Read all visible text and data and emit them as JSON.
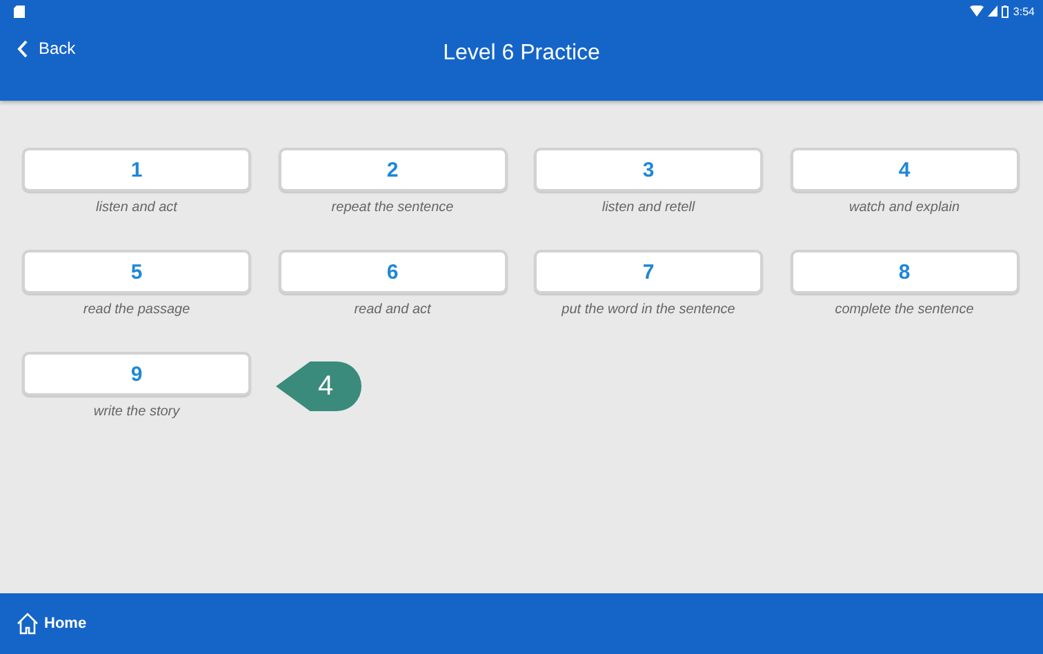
{
  "status_bar": {
    "time": "3:54"
  },
  "header": {
    "back": "Back",
    "title": "Level 6 Practice"
  },
  "lessons": [
    {
      "number": "1",
      "label": "listen and act"
    },
    {
      "number": "2",
      "label": "repeat the sentence"
    },
    {
      "number": "3",
      "label": "listen and retell"
    },
    {
      "number": "4",
      "label": "watch and explain"
    },
    {
      "number": "5",
      "label": "read the passage"
    },
    {
      "number": "6",
      "label": "read and act"
    },
    {
      "number": "7",
      "label": "put the word in the sentence"
    },
    {
      "number": "8",
      "label": "complete the sentence"
    },
    {
      "number": "9",
      "label": "write the story"
    }
  ],
  "callout": {
    "text": "4"
  },
  "footer": {
    "home": "Home"
  }
}
